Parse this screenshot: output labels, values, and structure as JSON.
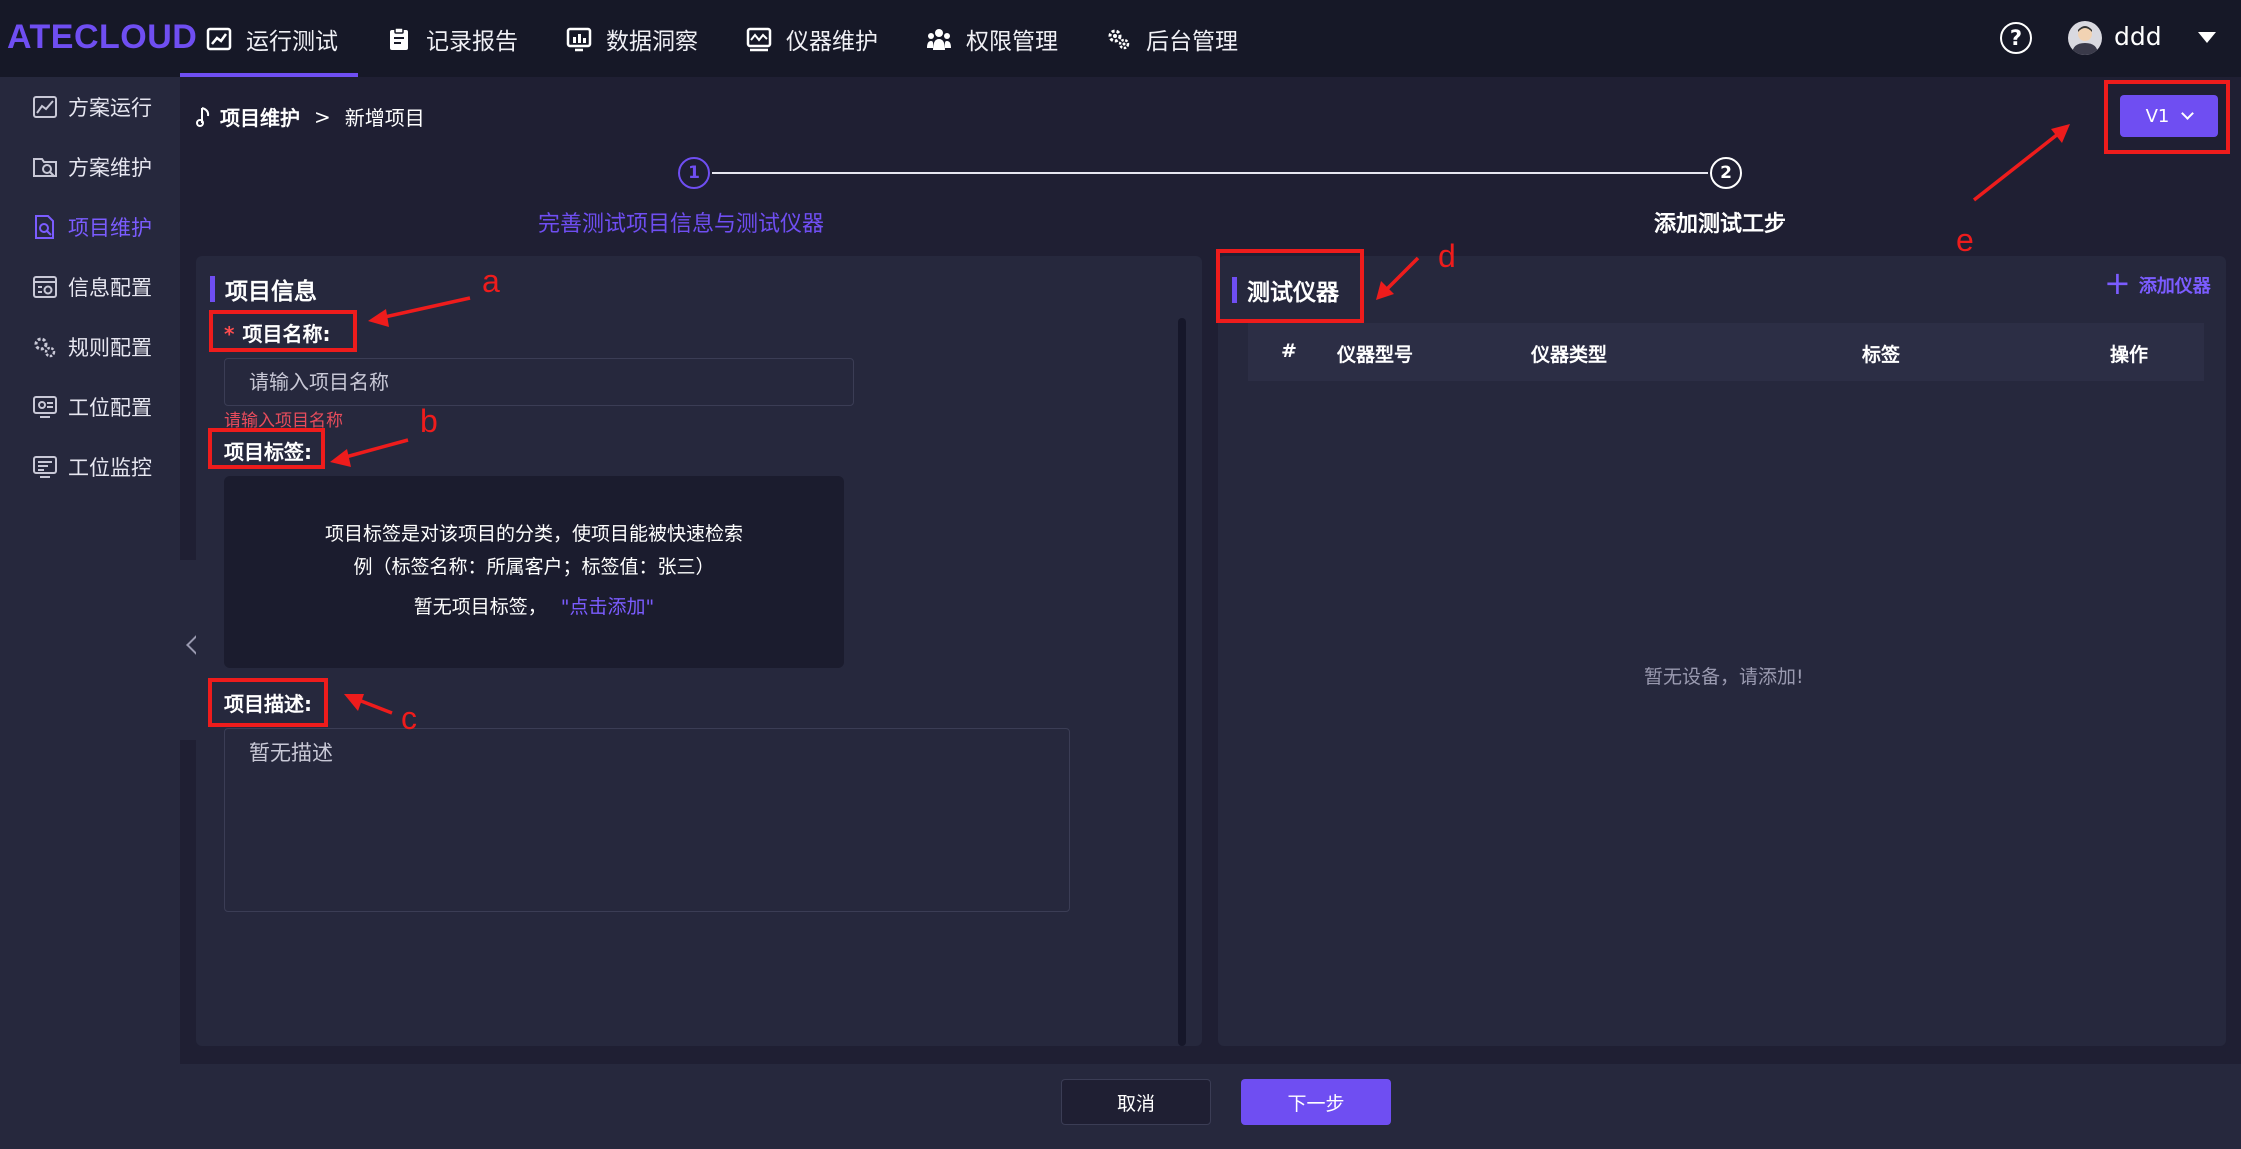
{
  "app": {
    "logo": "ATECLOUD"
  },
  "topnav": [
    {
      "label": "运行测试",
      "icon": "line-chart-icon",
      "active": true
    },
    {
      "label": "记录报告",
      "icon": "clipboard-icon"
    },
    {
      "label": "数据洞察",
      "icon": "bar-chart-icon"
    },
    {
      "label": "仪器维护",
      "icon": "monitor-wave-icon"
    },
    {
      "label": "权限管理",
      "icon": "users-icon"
    },
    {
      "label": "后台管理",
      "icon": "gears-icon"
    }
  ],
  "user": {
    "name": "ddd",
    "help_label": "?"
  },
  "sidebar": {
    "items": [
      {
        "label": "方案运行",
        "icon": "chart-icon"
      },
      {
        "label": "方案维护",
        "icon": "folder-search-icon"
      },
      {
        "label": "项目维护",
        "icon": "document-search-icon",
        "active": true
      },
      {
        "label": "信息配置",
        "icon": "settings-window-icon"
      },
      {
        "label": "规则配置",
        "icon": "gears-icon"
      },
      {
        "label": "工位配置",
        "icon": "monitor-settings-icon"
      },
      {
        "label": "工位监控",
        "icon": "dashboard-icon"
      }
    ]
  },
  "breadcrumb": {
    "main": "项目维护",
    "separator": ">",
    "current": "新增项目"
  },
  "version": {
    "label": "V1"
  },
  "steps": [
    {
      "number": "1",
      "label": "完善测试项目信息与测试仪器"
    },
    {
      "number": "2",
      "label": "添加测试工步"
    }
  ],
  "project_info": {
    "title": "项目信息",
    "name_label": "项目名称:",
    "required_mark": "*",
    "name_placeholder": "请输入项目名称",
    "name_error": "请输入项目名称",
    "tag_label": "项目标签:",
    "tag_help_line1": "项目标签是对该项目的分类，使项目能被快速检索",
    "tag_help_line2": "例（标签名称：所属客户；标签值：张三）",
    "tag_empty": "暂无项目标签，",
    "tag_add": "\"点击添加\"",
    "desc_label": "项目描述:",
    "desc_placeholder": "暂无描述"
  },
  "instruments": {
    "title": "测试仪器",
    "add_label": "添加仪器",
    "columns": [
      "#",
      "仪器型号",
      "仪器类型",
      "标签",
      "操作"
    ],
    "rows": [],
    "empty_text": "暂无设备，请添加!"
  },
  "footer": {
    "cancel_label": "取消",
    "next_label": "下一步"
  },
  "annotations": {
    "a": "a",
    "b": "b",
    "c": "c",
    "d": "d",
    "e": "e"
  },
  "colors": {
    "accent": "#6f4ef2",
    "error": "#e84c5c",
    "annotation": "#ee1c1c",
    "background": "#1f1f33",
    "panel": "#26283d",
    "topbar": "#161827"
  }
}
